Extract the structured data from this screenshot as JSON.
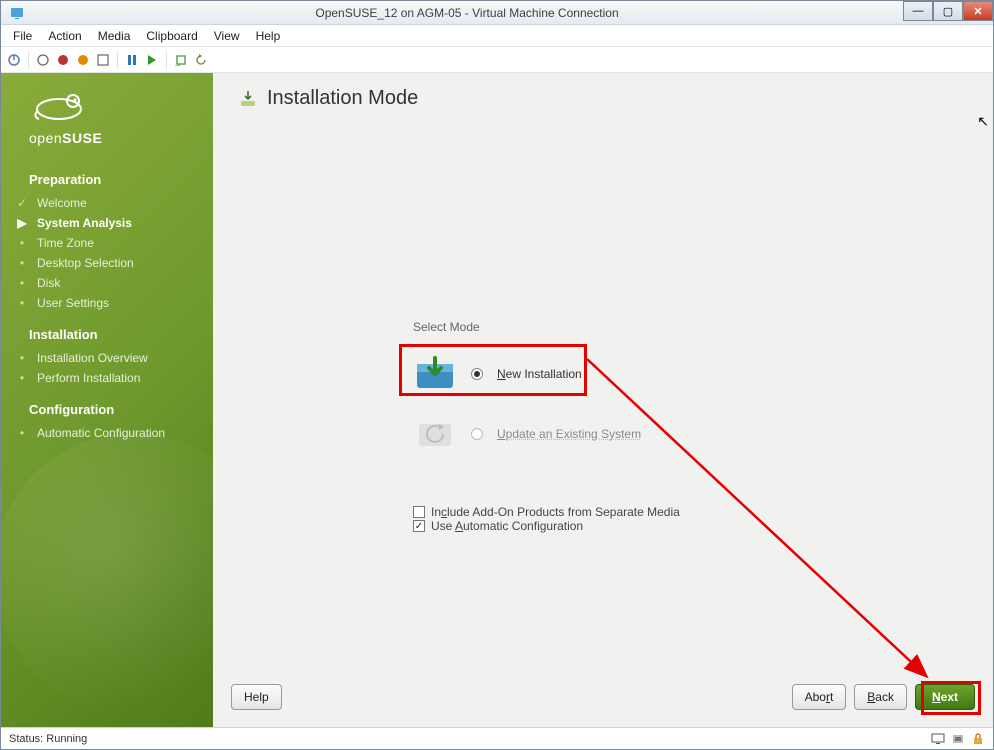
{
  "window": {
    "title": "OpenSUSE_12 on AGM-05 - Virtual Machine Connection"
  },
  "menubar": [
    "File",
    "Action",
    "Media",
    "Clipboard",
    "View",
    "Help"
  ],
  "sidebar": {
    "brand_prefix": "open",
    "brand_bold": "SUSE",
    "sections": [
      {
        "title": "Preparation",
        "items": [
          {
            "label": "Welcome",
            "state": "done"
          },
          {
            "label": "System Analysis",
            "state": "current"
          },
          {
            "label": "Time Zone",
            "state": "todo"
          },
          {
            "label": "Desktop Selection",
            "state": "todo"
          },
          {
            "label": "Disk",
            "state": "todo"
          },
          {
            "label": "User Settings",
            "state": "todo"
          }
        ]
      },
      {
        "title": "Installation",
        "items": [
          {
            "label": "Installation Overview",
            "state": "todo"
          },
          {
            "label": "Perform Installation",
            "state": "todo"
          }
        ]
      },
      {
        "title": "Configuration",
        "items": [
          {
            "label": "Automatic Configuration",
            "state": "todo"
          }
        ]
      }
    ]
  },
  "page": {
    "title": "Installation Mode",
    "group_label": "Select Mode",
    "options": [
      {
        "key": "new",
        "label_pre": "",
        "label_u": "N",
        "label_post": "ew Installation",
        "selected": true,
        "enabled": true
      },
      {
        "key": "update",
        "label_pre": "",
        "label_u": "U",
        "label_post": "pdate an Existing System",
        "selected": false,
        "enabled": false
      }
    ],
    "checkboxes": [
      {
        "key": "addon",
        "checked": false,
        "label_pre": "In",
        "label_u": "c",
        "label_post": "lude Add-On Products from Separate Media"
      },
      {
        "key": "autocfg",
        "checked": true,
        "label_pre": "Use ",
        "label_u": "A",
        "label_post": "utomatic Configuration"
      }
    ]
  },
  "footer": {
    "help": "Help",
    "abort": "Abort",
    "back": "Back",
    "next": "Next",
    "abort_u": "r",
    "back_u": "B",
    "next_u": "N"
  },
  "statusbar": {
    "text": "Status: Running"
  },
  "colors": {
    "accent_red": "#e30000",
    "suse_green": "#5f8f1f"
  }
}
